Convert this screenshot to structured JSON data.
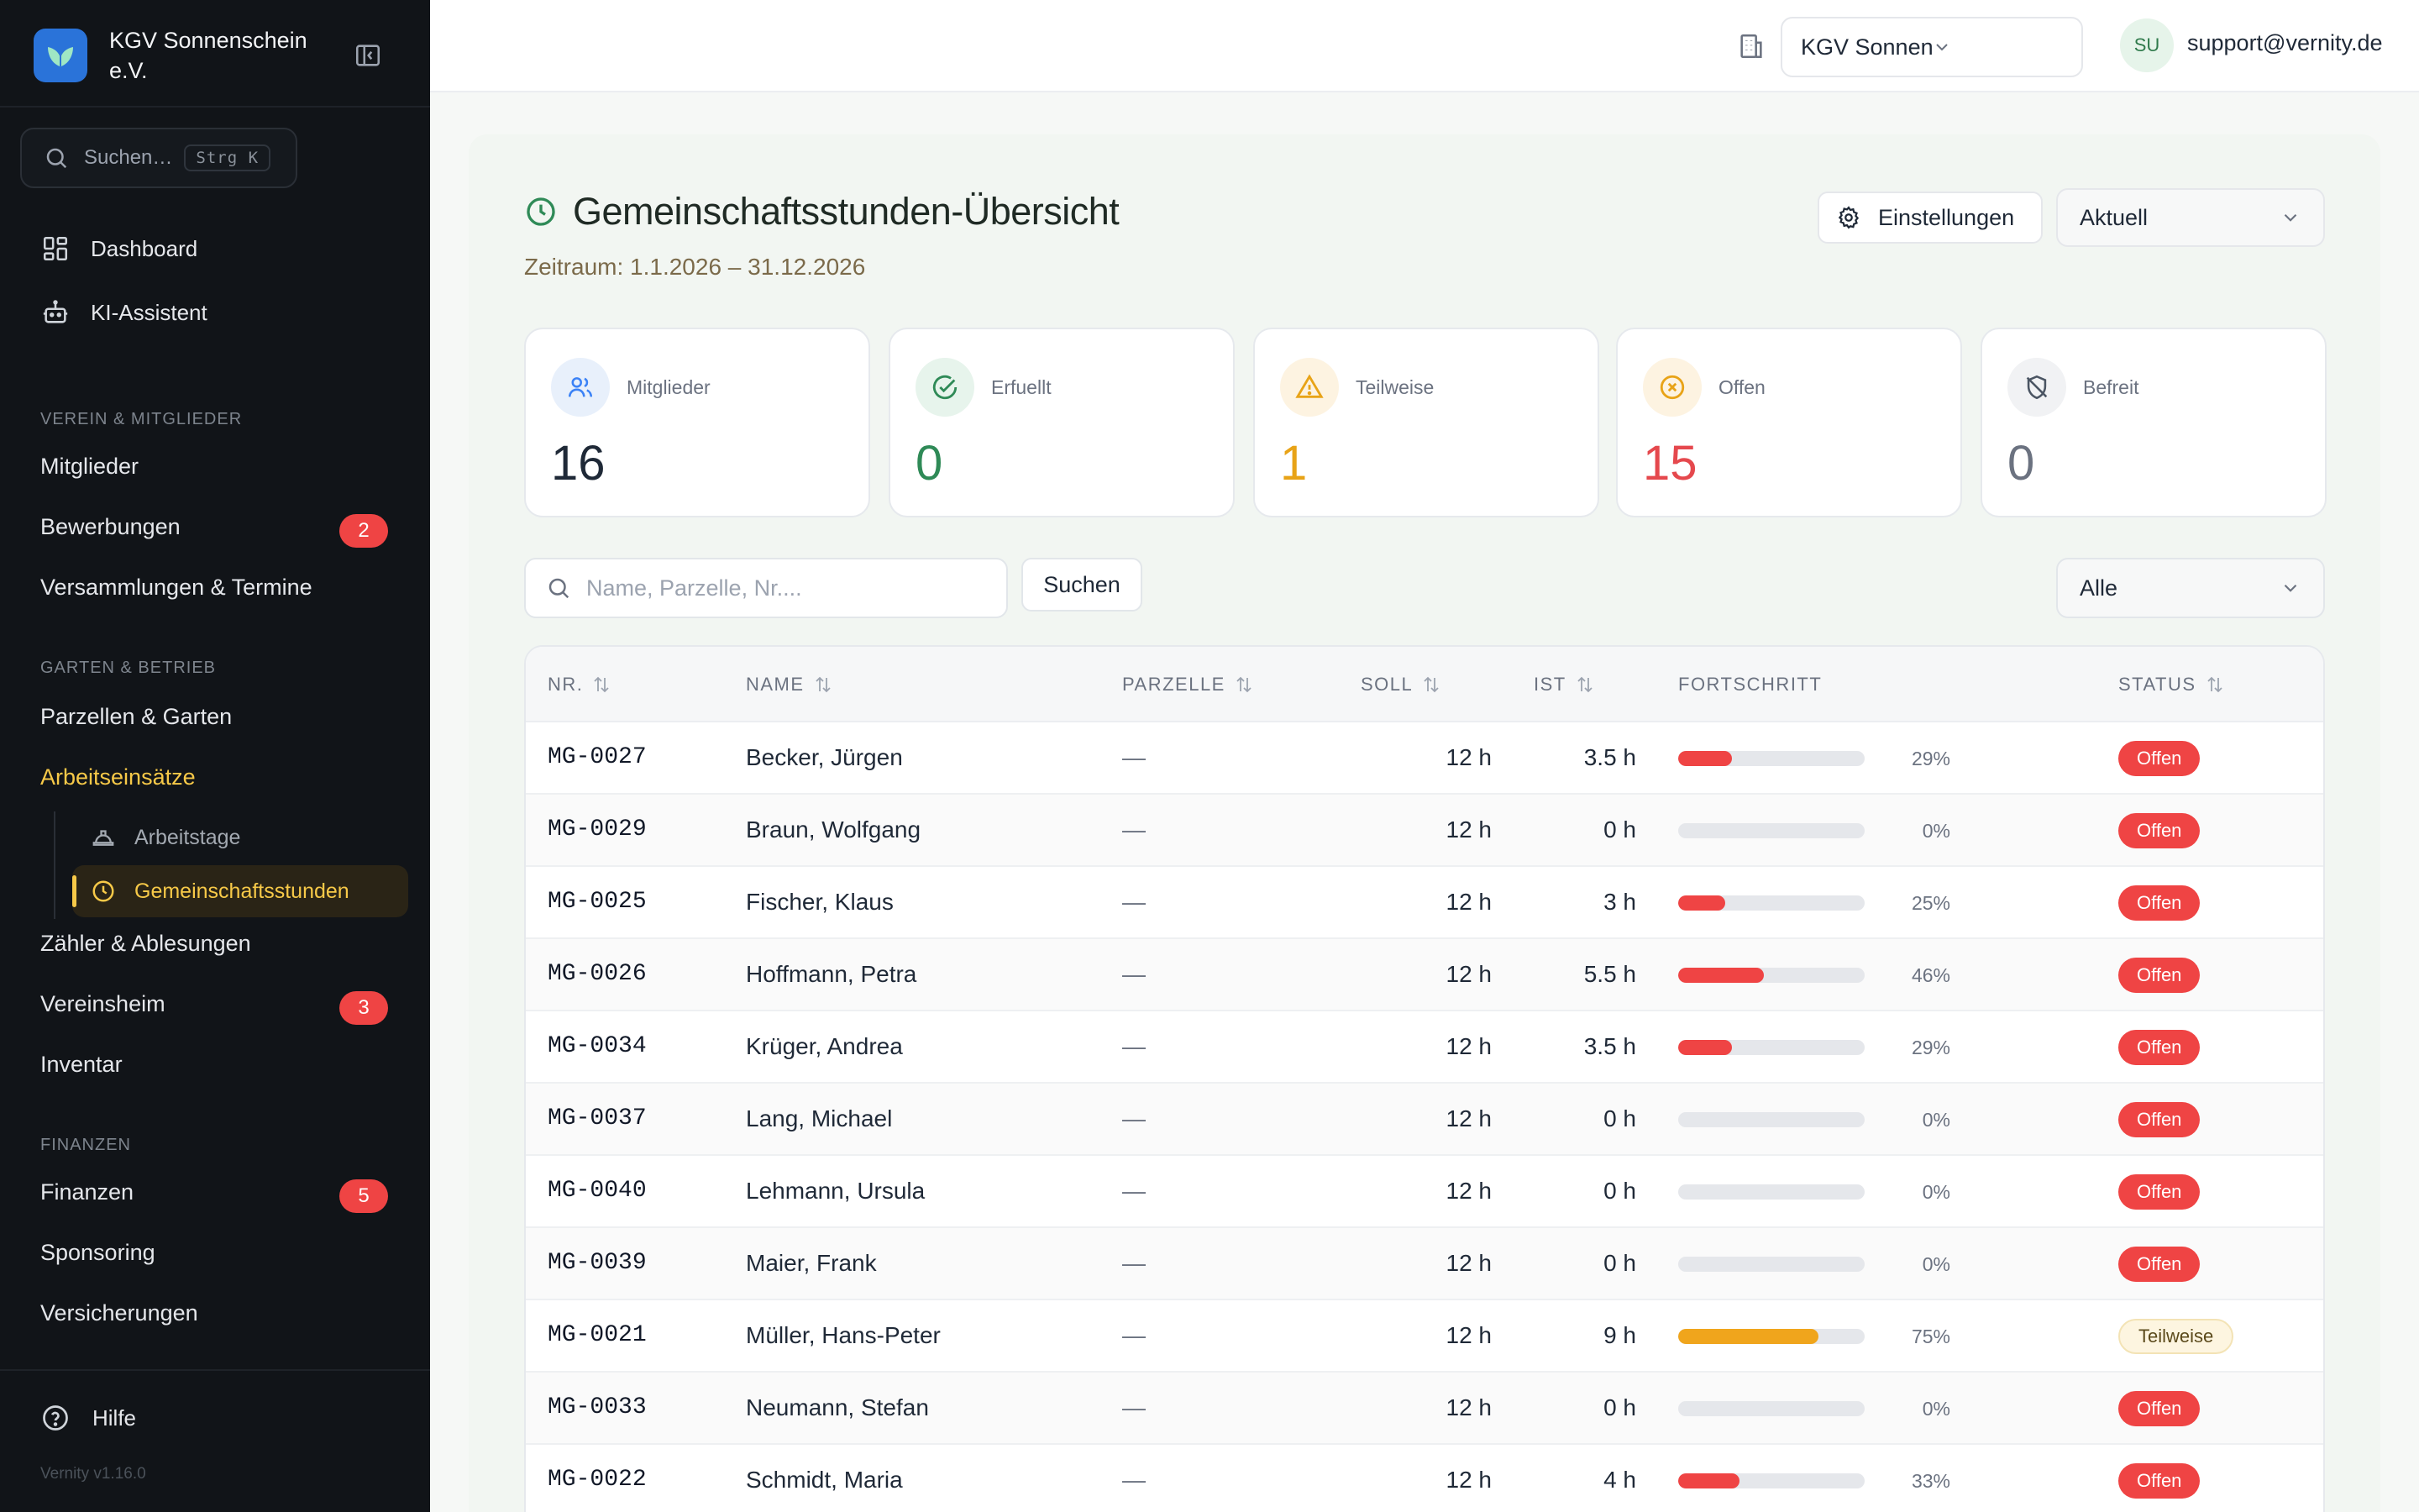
{
  "sidebar": {
    "org_name": "KGV Sonnenschein e.V.",
    "search_placeholder": "Suchen…",
    "search_shortcut": "Strg K",
    "top_items": [
      {
        "label": "Dashboard",
        "icon": "dashboard-icon"
      },
      {
        "label": "KI-Assistent",
        "icon": "robot-icon"
      }
    ],
    "sections": [
      {
        "title": "VEREIN & MITGLIEDER",
        "items": [
          {
            "label": "Mitglieder",
            "badge": ""
          },
          {
            "label": "Bewerbungen",
            "badge": "2"
          },
          {
            "label": "Versammlungen & Termine",
            "badge": ""
          }
        ]
      },
      {
        "title": "GARTEN & BETRIEB",
        "items": [
          {
            "label": "Parzellen & Garten",
            "badge": ""
          },
          {
            "label": "Arbeitseinsätze",
            "badge": "",
            "active": true
          },
          {
            "label": "Zähler & Ablesungen",
            "badge": ""
          },
          {
            "label": "Vereinsheim",
            "badge": "3"
          },
          {
            "label": "Inventar",
            "badge": ""
          }
        ]
      },
      {
        "title": "FINANZEN",
        "items": [
          {
            "label": "Finanzen",
            "badge": "5"
          },
          {
            "label": "Sponsoring",
            "badge": ""
          },
          {
            "label": "Versicherungen",
            "badge": ""
          }
        ]
      }
    ],
    "sub_items": [
      {
        "label": "Arbeitstage",
        "icon": "hard-hat-icon",
        "active": false
      },
      {
        "label": "Gemeinschaftsstunden",
        "icon": "clock-icon",
        "active": true
      }
    ],
    "help_label": "Hilfe",
    "version": "Vernity v1.16.0"
  },
  "topbar": {
    "org_select": "KGV Sonnenschein e.V.",
    "avatar_initials": "SU",
    "user_email": "support@vernity.de"
  },
  "page": {
    "title": "Gemeinschaftsstunden-Übersicht",
    "subtitle": "Zeitraum: 1.1.2026 – 31.12.2026",
    "settings_label": "Einstellungen",
    "period_select": "Aktuell",
    "search_placeholder": "Name, Parzelle, Nr....",
    "search_button": "Suchen",
    "status_filter": "Alle"
  },
  "stats": [
    {
      "label": "Mitglieder",
      "value": "16",
      "icon": "users-icon",
      "color": "#1f2937",
      "icon_bg": "#e8f0fb",
      "icon_color": "#3b82f6"
    },
    {
      "label": "Erfuellt",
      "value": "0",
      "icon": "check-circle-icon",
      "color": "#2f8a57",
      "icon_bg": "#e7f4ec",
      "icon_color": "#2f8a57"
    },
    {
      "label": "Teilweise",
      "value": "1",
      "icon": "warning-icon",
      "color": "#e8a317",
      "icon_bg": "#fdf3e1",
      "icon_color": "#e8a317"
    },
    {
      "label": "Offen",
      "value": "15",
      "icon": "x-circle-icon",
      "color": "#e5484d",
      "icon_bg": "#fdf3e1",
      "icon_color": "#e8a317"
    },
    {
      "label": "Befreit",
      "value": "0",
      "icon": "shield-off-icon",
      "color": "#6b7280",
      "icon_bg": "#f1f2f4",
      "icon_color": "#4b5563"
    }
  ],
  "table": {
    "columns": [
      "NR.",
      "NAME",
      "PARZELLE",
      "SOLL",
      "IST",
      "FORTSCHRITT",
      "STATUS"
    ],
    "rows": [
      {
        "nr": "MG-0027",
        "name": "Becker, Jürgen",
        "parzelle": "—",
        "soll": "12 h",
        "ist": "3.5 h",
        "progress": 29,
        "pct": "29%",
        "status": "Offen"
      },
      {
        "nr": "MG-0029",
        "name": "Braun, Wolfgang",
        "parzelle": "—",
        "soll": "12 h",
        "ist": "0 h",
        "progress": 0,
        "pct": "0%",
        "status": "Offen"
      },
      {
        "nr": "MG-0025",
        "name": "Fischer, Klaus",
        "parzelle": "—",
        "soll": "12 h",
        "ist": "3 h",
        "progress": 25,
        "pct": "25%",
        "status": "Offen"
      },
      {
        "nr": "MG-0026",
        "name": "Hoffmann, Petra",
        "parzelle": "—",
        "soll": "12 h",
        "ist": "5.5 h",
        "progress": 46,
        "pct": "46%",
        "status": "Offen"
      },
      {
        "nr": "MG-0034",
        "name": "Krüger, Andrea",
        "parzelle": "—",
        "soll": "12 h",
        "ist": "3.5 h",
        "progress": 29,
        "pct": "29%",
        "status": "Offen"
      },
      {
        "nr": "MG-0037",
        "name": "Lang, Michael",
        "parzelle": "—",
        "soll": "12 h",
        "ist": "0 h",
        "progress": 0,
        "pct": "0%",
        "status": "Offen"
      },
      {
        "nr": "MG-0040",
        "name": "Lehmann, Ursula",
        "parzelle": "—",
        "soll": "12 h",
        "ist": "0 h",
        "progress": 0,
        "pct": "0%",
        "status": "Offen"
      },
      {
        "nr": "MG-0039",
        "name": "Maier, Frank",
        "parzelle": "—",
        "soll": "12 h",
        "ist": "0 h",
        "progress": 0,
        "pct": "0%",
        "status": "Offen"
      },
      {
        "nr": "MG-0021",
        "name": "Müller, Hans-Peter",
        "parzelle": "—",
        "soll": "12 h",
        "ist": "9 h",
        "progress": 75,
        "pct": "75%",
        "status": "Teilweise"
      },
      {
        "nr": "MG-0033",
        "name": "Neumann, Stefan",
        "parzelle": "—",
        "soll": "12 h",
        "ist": "0 h",
        "progress": 0,
        "pct": "0%",
        "status": "Offen"
      },
      {
        "nr": "MG-0022",
        "name": "Schmidt, Maria",
        "parzelle": "—",
        "soll": "12 h",
        "ist": "4 h",
        "progress": 33,
        "pct": "33%",
        "status": "Offen"
      }
    ]
  },
  "colors": {
    "accent": "#f7c948",
    "offen": "#ef4444",
    "teilweise": "#f0a51c",
    "progress_track": "#e5e7eb",
    "title_icon": "#2f8a57"
  }
}
